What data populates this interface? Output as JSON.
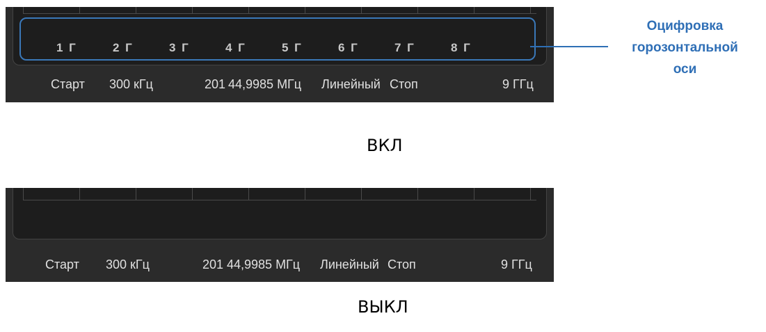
{
  "state_on": {
    "axis_labels": [
      "1 Г",
      "2 Г",
      "3 Г",
      "4 Г",
      "5 Г",
      "6 Г",
      "7 Г",
      "8 Г"
    ],
    "status": {
      "start_label": "Старт",
      "start_value": "300 кГц",
      "points": "201",
      "step": "44,9985 МГц",
      "sweep_type": "Линейный",
      "stop_label": "Стоп",
      "stop_value": "9 ГГц"
    },
    "caption": "ВКЛ"
  },
  "state_off": {
    "status": {
      "start_label": "Старт",
      "start_value": "300 кГц",
      "points": "201",
      "step": "44,9985 МГц",
      "sweep_type": "Линейный",
      "stop_label": "Стоп",
      "stop_value": "9 ГГц"
    },
    "caption": "ВЫКЛ"
  },
  "callout": {
    "lines": [
      "Оцифровка",
      "горозонтальной",
      "оси"
    ]
  },
  "colors": {
    "panel_bg": "#2b2b2b",
    "plot_bg": "#1d1d1d",
    "accent": "#2f6fb6",
    "axis_text": "#c8c8c8"
  }
}
